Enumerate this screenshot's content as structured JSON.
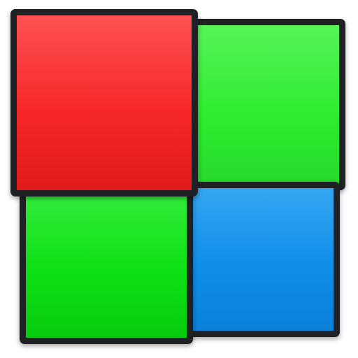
{
  "icon": {
    "name": "four-color-squares-icon",
    "tiles": [
      {
        "name": "tile-red-top-left",
        "color": "#ef1d1f",
        "color_light": "#ff3436"
      },
      {
        "name": "tile-green-top-right",
        "color": "#28e72b",
        "color_light": "#38f23a"
      },
      {
        "name": "tile-green-bottom-left",
        "color": "#08d810",
        "color_light": "#12e81a"
      },
      {
        "name": "tile-blue-bottom-right",
        "color": "#0b88e6",
        "color_light": "#1496ee"
      }
    ],
    "border_color": "#1f2124"
  }
}
